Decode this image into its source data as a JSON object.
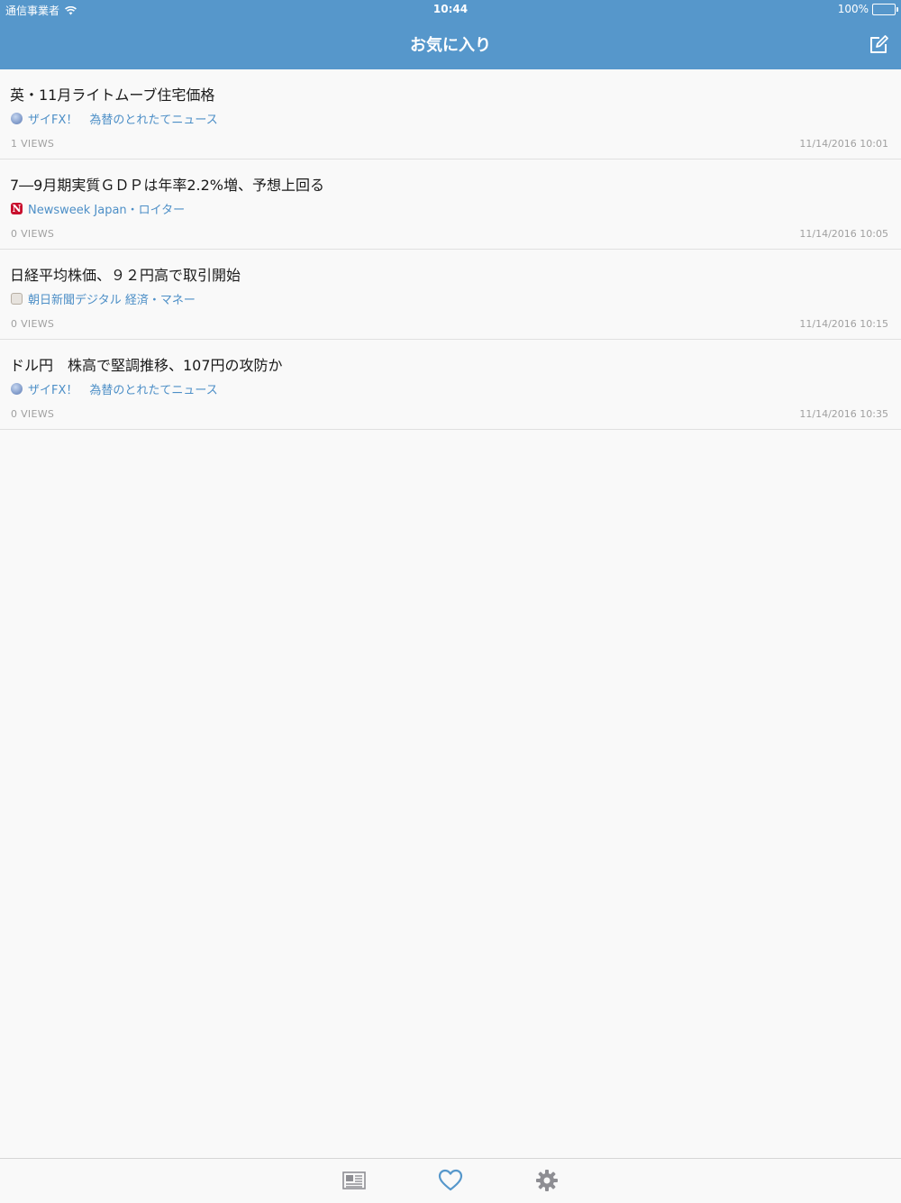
{
  "status_bar": {
    "carrier": "通信事業者",
    "time": "10:44",
    "battery": "100%"
  },
  "nav": {
    "title": "お気に入り",
    "edit_icon": "compose-icon"
  },
  "articles": [
    {
      "title": "英・11月ライトムーブ住宅価格",
      "source": "ザイFX！　為替のとれたてニュース",
      "source_icon": "globe-icon",
      "views": "1 VIEWS",
      "date": "11/14/2016 10:01"
    },
    {
      "title": "7―9月期実質ＧＤＰは年率2.2%増、予想上回る",
      "source": "Newsweek Japan・ロイター",
      "source_icon": "newsweek-logo-icon",
      "views": "0 VIEWS",
      "date": "11/14/2016 10:05"
    },
    {
      "title": "日経平均株価、９２円高で取引開始",
      "source": "朝日新聞デジタル 経済・マネー",
      "source_icon": "asahi-logo-icon",
      "views": "0 VIEWS",
      "date": "11/14/2016 10:15"
    },
    {
      "title": "ドル円　株高で堅調推移、107円の攻防か",
      "source": "ザイFX！　為替のとれたてニュース",
      "source_icon": "globe-icon",
      "views": "0 VIEWS",
      "date": "11/14/2016 10:35"
    }
  ],
  "tabs": [
    {
      "icon": "newspaper-icon",
      "selected": false
    },
    {
      "icon": "heart-icon",
      "selected": true
    },
    {
      "icon": "gear-icon",
      "selected": false
    }
  ],
  "colors": {
    "accent": "#5697cb",
    "link": "#4d8fc7",
    "tab_inactive": "#8e8e93"
  }
}
